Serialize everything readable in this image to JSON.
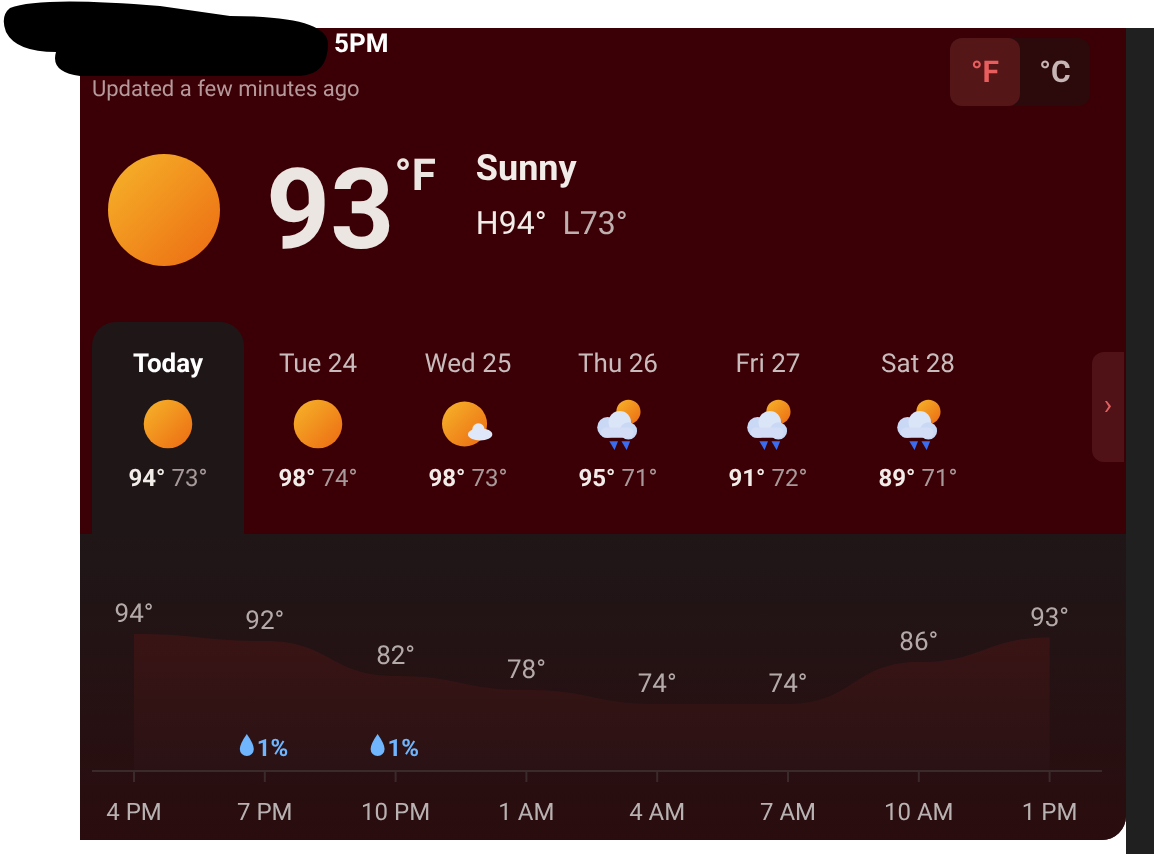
{
  "header": {
    "time": "5PM",
    "updated": "Updated a few minutes ago"
  },
  "units": [
    {
      "label": "°F",
      "selected": true
    },
    {
      "label": "°C",
      "selected": false
    }
  ],
  "current": {
    "kind": "sunny",
    "temp": "93",
    "unit": "°F",
    "condition": "Sunny",
    "high": "H94°",
    "low": "L73°"
  },
  "days": [
    {
      "label": "Today",
      "kind": "sunny",
      "high": "94°",
      "low": "73°",
      "selected": true
    },
    {
      "label": "Tue 24",
      "kind": "sunny",
      "high": "98°",
      "low": "74°",
      "selected": false
    },
    {
      "label": "Wed 25",
      "kind": "partly-cloudy",
      "high": "98°",
      "low": "73°",
      "selected": false
    },
    {
      "label": "Thu 26",
      "kind": "rain",
      "high": "95°",
      "low": "71°",
      "selected": false
    },
    {
      "label": "Fri 27",
      "kind": "rain",
      "high": "91°",
      "low": "72°",
      "selected": false
    },
    {
      "label": "Sat 28",
      "kind": "rain",
      "high": "89°",
      "low": "71°",
      "selected": false
    }
  ],
  "next_button": "›",
  "hourly": {
    "chart_data": {
      "type": "area",
      "categories": [
        "4 PM",
        "7 PM",
        "10 PM",
        "1 AM",
        "4 AM",
        "7 AM",
        "10 AM",
        "1 PM"
      ],
      "values": [
        94,
        92,
        82,
        78,
        74,
        74,
        86,
        93
      ],
      "value_labels": [
        "94°",
        "92°",
        "82°",
        "78°",
        "74°",
        "74°",
        "86°",
        "93°"
      ],
      "annotations": [
        {
          "x": "7 PM",
          "text": "1%"
        },
        {
          "x": "10 PM",
          "text": "1%"
        }
      ]
    }
  }
}
